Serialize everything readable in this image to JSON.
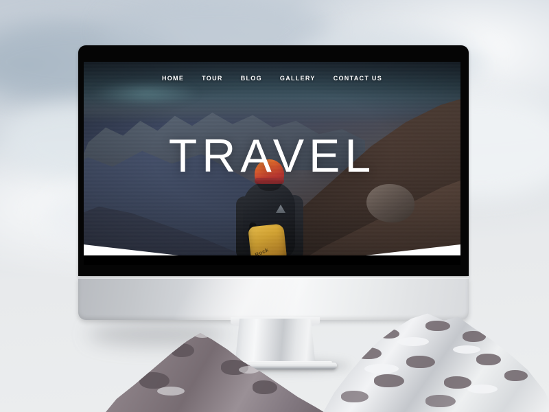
{
  "scene": {
    "type": "desktop-monitor-mockup",
    "background": "cloudy-sky",
    "device": "imac-style-desktop-monitor",
    "foreground": "snow-mountain-peaks"
  },
  "website": {
    "nav": {
      "items": [
        {
          "label": "HOME",
          "name": "nav-home"
        },
        {
          "label": "TOUR",
          "name": "nav-tour"
        },
        {
          "label": "BLOG",
          "name": "nav-blog"
        },
        {
          "label": "GALLERY",
          "name": "nav-gallery"
        },
        {
          "label": "CONTACT US",
          "name": "nav-contact-us"
        }
      ]
    },
    "hero": {
      "title": "TRAVEL",
      "image_alt": "hiker-in-mountains",
      "backpack_text": "Rock"
    }
  },
  "colors": {
    "nav_text": "#ffffff",
    "hero_title": "#ffffff",
    "bezel": "#050505",
    "chin_light": "#f6f7f8",
    "chin_dark": "#b8bbc0",
    "hero_sky": "#2f4450",
    "hat": "#b9362f",
    "backpack": "#e0ad35",
    "background_sky": "#dde2e7"
  }
}
